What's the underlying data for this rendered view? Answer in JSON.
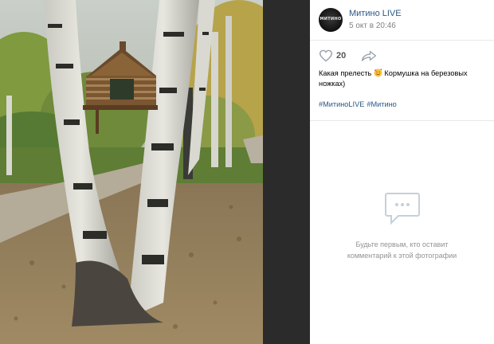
{
  "post": {
    "author": "Митино LIVE",
    "avatar_text": "МИТИНО",
    "date": "5 окт в 20:46",
    "likes": "20",
    "caption_part1": "Какая прелесть",
    "caption_emoji": "smiling-face-with-hearts",
    "caption_part2": " Кормушка на березовых ножках)",
    "tags": [
      "#МитиноLIVE",
      "#Митино"
    ]
  },
  "comments": {
    "empty_line1": "Будьте первым, кто оставит",
    "empty_line2": "комментарий к этой фотографии"
  },
  "icons": {
    "like": "heart-icon",
    "share": "share-arrow-icon",
    "empty_comments": "chat-bubble-icon"
  },
  "colors": {
    "link": "#2a5885",
    "muted": "#828282",
    "viewer_bg": "#1f1f1f"
  }
}
